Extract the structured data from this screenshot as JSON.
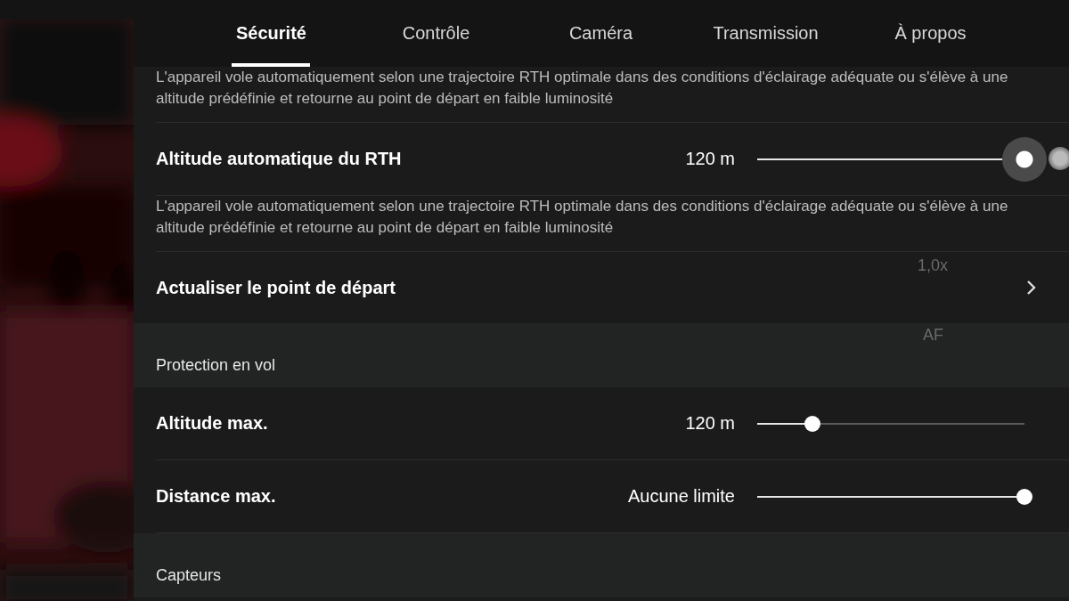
{
  "tabs": [
    {
      "label": "Sécurité",
      "selected": true
    },
    {
      "label": "Contrôle",
      "selected": false
    },
    {
      "label": "Caméra",
      "selected": false
    },
    {
      "label": "Transmission",
      "selected": false
    },
    {
      "label": "À propos",
      "selected": false
    }
  ],
  "groups": [
    {
      "items": [
        {
          "kind": "note",
          "text": "L'appareil vole automatiquement selon une trajectoire RTH optimale dans des conditions d'éclairage adéquate ou s'élève à une altitude prédéfinie et retourne au point de départ en faible luminosité"
        },
        {
          "kind": "slider",
          "label": "Altitude automatique du RTH",
          "value": "120 m",
          "level": 1,
          "pressed": true
        },
        {
          "kind": "note",
          "text": "L'appareil vole automatiquement selon une trajectoire RTH optimale dans des conditions d'éclairage adéquate ou s'élève à une altitude prédéfinie et retourne au point de départ en faible luminosité"
        },
        {
          "kind": "link",
          "label": "Actualiser le point de départ"
        }
      ]
    },
    {
      "header": "Protection en vol",
      "items": [
        {
          "kind": "slider",
          "label": "Altitude max.",
          "value": "120 m",
          "level": 0.207,
          "pressed": false
        },
        {
          "kind": "slider",
          "label": "Distance max.",
          "value": "Aucune limite",
          "level": 1,
          "pressed": false
        }
      ]
    },
    {
      "header": "Capteurs"
    }
  ],
  "overlay_labels": [
    "1,0x",
    "AF"
  ]
}
